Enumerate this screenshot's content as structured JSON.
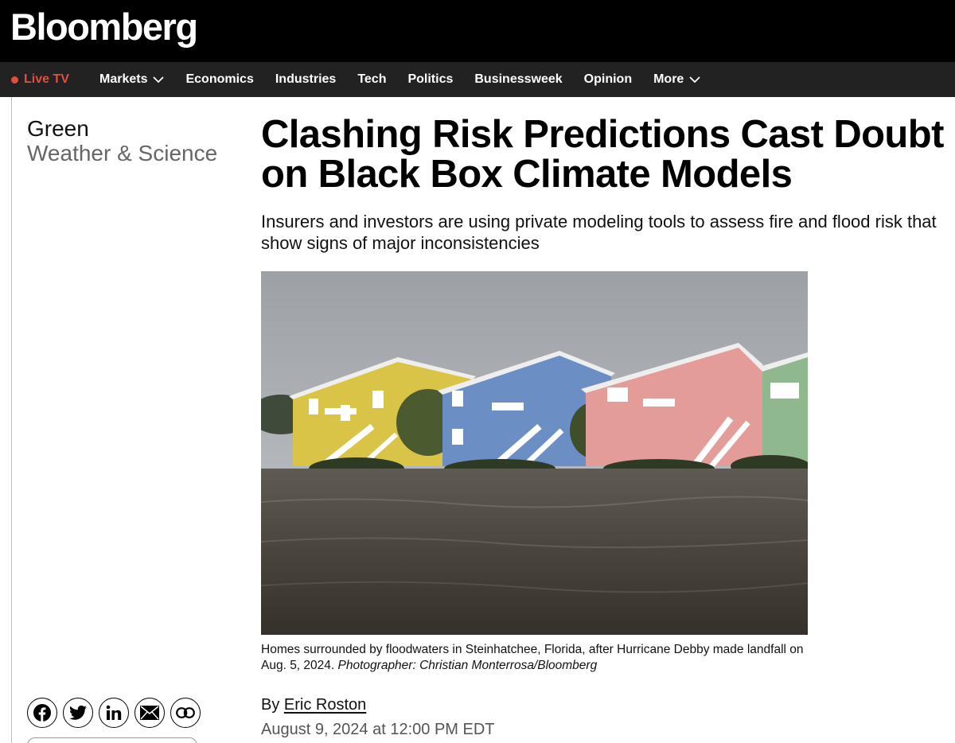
{
  "brand": {
    "name": "Bloomberg"
  },
  "nav": {
    "live_tv": "Live TV",
    "live_color": "#e24e3f",
    "items": [
      {
        "label": "Markets",
        "has_dropdown": true
      },
      {
        "label": "Economics",
        "has_dropdown": false
      },
      {
        "label": "Industries",
        "has_dropdown": false
      },
      {
        "label": "Tech",
        "has_dropdown": false
      },
      {
        "label": "Politics",
        "has_dropdown": false
      },
      {
        "label": "Businessweek",
        "has_dropdown": false
      },
      {
        "label": "Opinion",
        "has_dropdown": false
      },
      {
        "label": "More",
        "has_dropdown": true
      }
    ]
  },
  "section": {
    "primary": "Green",
    "secondary": "Weather & Science"
  },
  "article": {
    "headline": "Clashing Risk Predictions Cast Doubt on Black Box Climate Models",
    "dek": "Insurers and investors are using private modeling tools to assess fire and flood risk that show signs of major inconsistencies",
    "caption": "Homes surrounded by floodwaters in Steinhatchee, Florida, after Hurricane Debby made landfall on Aug. 5, 2024.",
    "photo_credit": "Photographer: Christian Monterrosa/Bloomberg",
    "byline_prefix": "By",
    "author": "Eric Roston",
    "date": "August 9, 2024 at 12:00 PM EDT"
  },
  "share": [
    {
      "name": "facebook",
      "icon": "facebook-icon"
    },
    {
      "name": "twitter",
      "icon": "twitter-icon"
    },
    {
      "name": "linkedin",
      "icon": "linkedin-icon"
    },
    {
      "name": "email",
      "icon": "email-icon"
    },
    {
      "name": "copy-link",
      "icon": "link-icon"
    }
  ]
}
